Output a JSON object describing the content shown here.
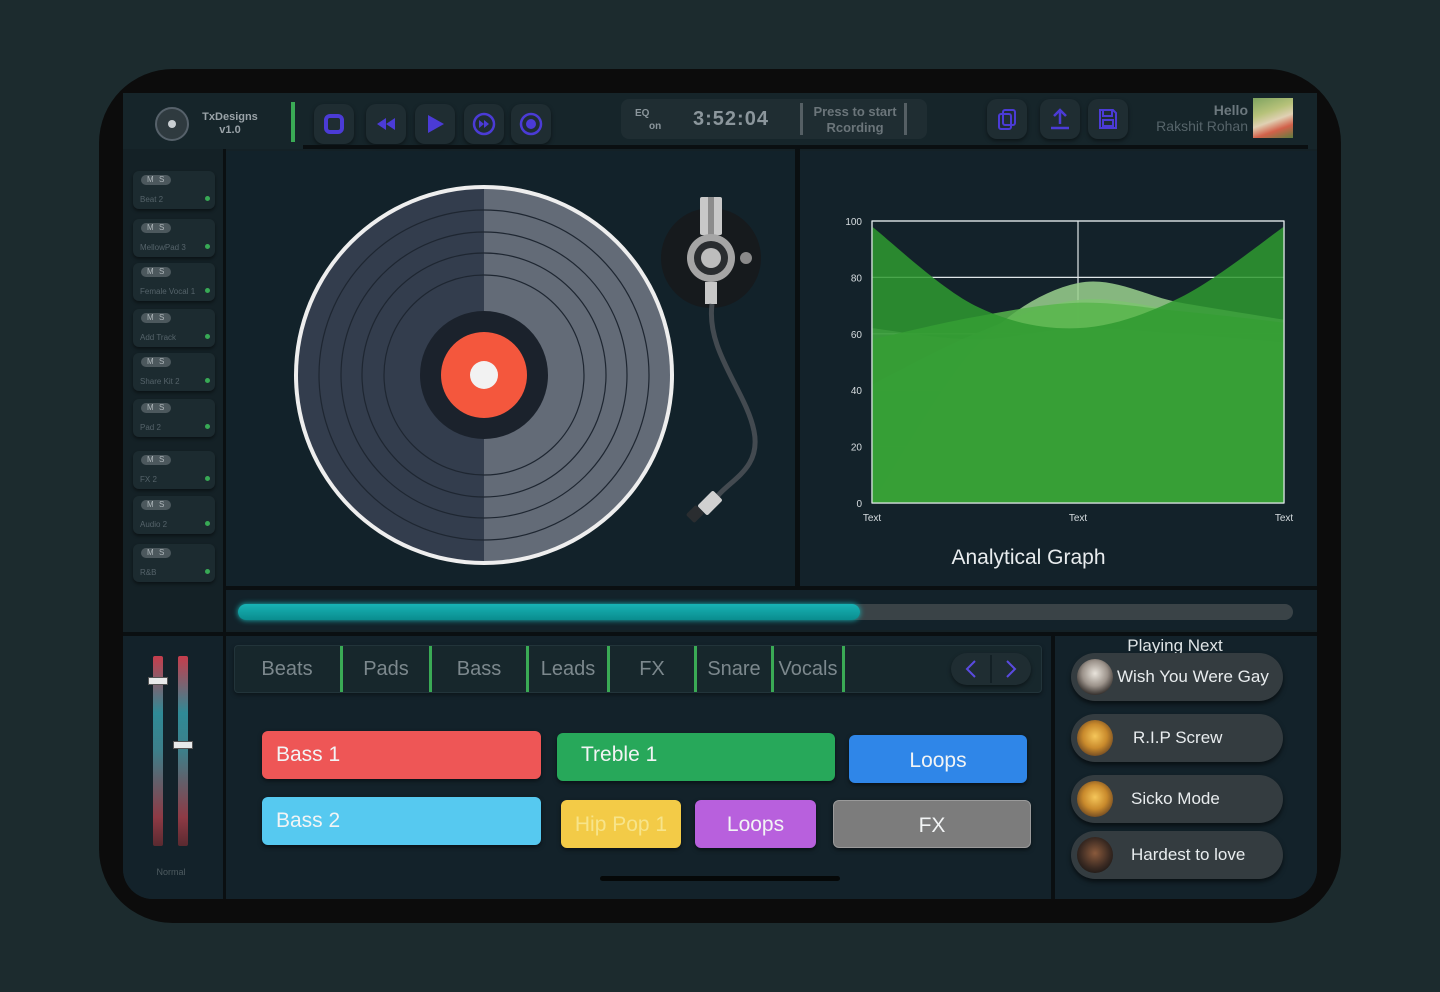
{
  "brand": {
    "name": "TxDesigns",
    "version": "v1.0"
  },
  "transport": {
    "stop": "stop-icon",
    "rewind": "rewind-icon",
    "play": "play-icon",
    "fast_forward": "fast-forward-icon",
    "record": "record-icon"
  },
  "display": {
    "eq_label": "EQ",
    "eq_state": "on",
    "time": "3:52:04",
    "record_line1": "Press to start",
    "record_line2": "Rcording"
  },
  "actions": {
    "copy": "copy-icon",
    "upload": "upload-icon",
    "save": "save-icon"
  },
  "user": {
    "greeting": "Hello",
    "name": "Rakshit Rohan"
  },
  "tracks": [
    {
      "mute": "M",
      "solo": "S",
      "name": "Beat 2"
    },
    {
      "mute": "M",
      "solo": "S",
      "name": "MellowPad 3"
    },
    {
      "mute": "M",
      "solo": "S",
      "name": "Female Vocal 1"
    },
    {
      "mute": "M",
      "solo": "S",
      "name": "Add Track"
    },
    {
      "mute": "M",
      "solo": "S",
      "name": "Share Kit 2"
    },
    {
      "mute": "M",
      "solo": "S",
      "name": "Pad 2"
    },
    {
      "mute": "M",
      "solo": "S",
      "name": "FX 2"
    },
    {
      "mute": "M",
      "solo": "S",
      "name": "Audio 2"
    },
    {
      "mute": "M",
      "solo": "S",
      "name": "R&B"
    }
  ],
  "progress": {
    "value": 0.59
  },
  "mixer": {
    "label": "Normal",
    "fader_left": 0.87,
    "fader_right": 0.53
  },
  "tabs": [
    "Beats",
    "Pads",
    "Bass",
    "Leads",
    "FX",
    "Snare",
    "Vocals"
  ],
  "pads": [
    "Bass 1",
    "Treble 1",
    "Loops",
    "Bass 2",
    "Hip Pop 1",
    "Loops",
    "FX"
  ],
  "playing_next": {
    "title": "Playing Next",
    "songs": [
      "Wish You Were Gay",
      "R.I.P Screw",
      "Sicko Mode",
      "Hardest to love"
    ]
  },
  "chart_data": {
    "type": "area",
    "title": "Analytical Graph",
    "x_ticks": [
      "Text",
      "Text",
      "Text"
    ],
    "y_ticks": [
      0,
      20,
      40,
      60,
      80,
      100
    ],
    "ylim": [
      0,
      100
    ],
    "grid": true,
    "series": [
      {
        "values": [
          0,
          55,
          78,
          71,
          65
        ]
      },
      {
        "values": [
          42,
          60,
          72,
          68,
          62
        ]
      },
      {
        "values": [
          62,
          58,
          62,
          60,
          57
        ]
      },
      {
        "values": [
          58,
          66,
          71,
          68,
          64
        ]
      },
      {
        "values": [
          98,
          70,
          62,
          73,
          98
        ]
      }
    ],
    "colors": [
      "#9bd18e",
      "#7dc470",
      "#c7e6bb",
      "#58b54c",
      "#2f9a30"
    ]
  }
}
